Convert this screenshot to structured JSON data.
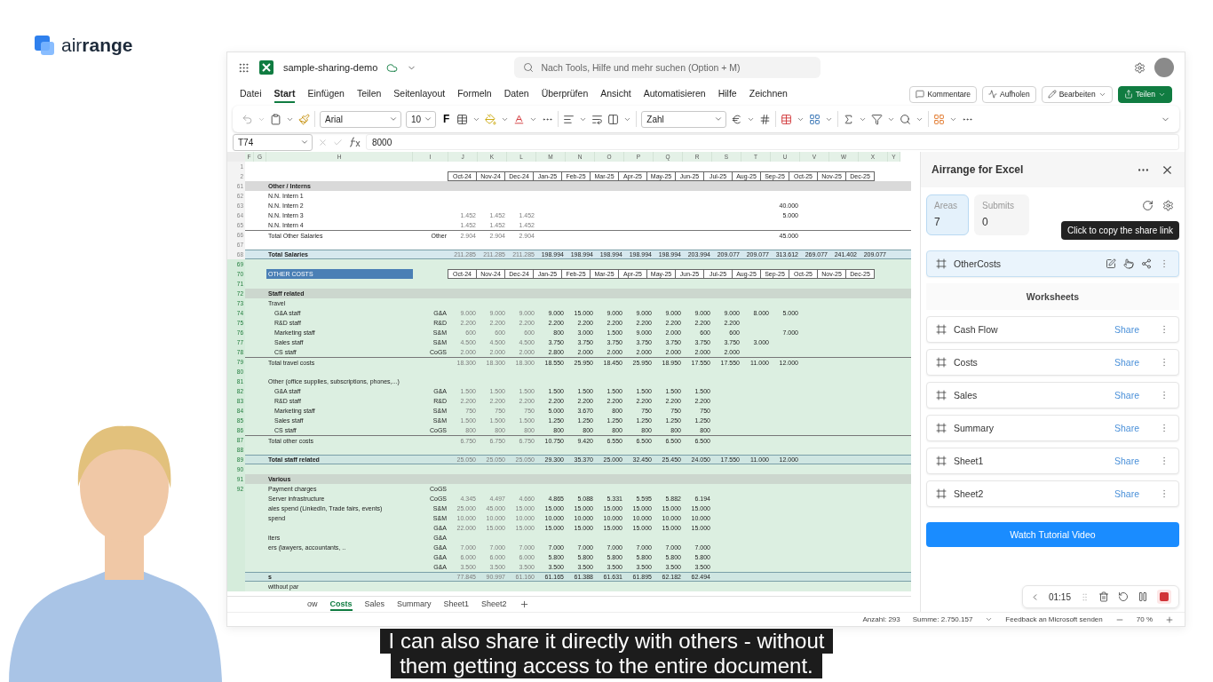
{
  "brand": {
    "name": "air**range**"
  },
  "app": {
    "document": "sample-sharing-demo",
    "search": {
      "placeholder": "Nach Tools, Hilfe und mehr suchen (Option + M)"
    }
  },
  "menu": {
    "tabs": [
      {
        "label": "Datei",
        "selected": false
      },
      {
        "label": "Start",
        "selected": true
      },
      {
        "label": "Einfügen",
        "selected": false
      },
      {
        "label": "Teilen",
        "selected": false
      },
      {
        "label": "Seitenlayout",
        "selected": false
      },
      {
        "label": "Formeln",
        "selected": false
      },
      {
        "label": "Daten",
        "selected": false
      },
      {
        "label": "Überprüfen",
        "selected": false
      },
      {
        "label": "Ansicht",
        "selected": false
      },
      {
        "label": "Automatisieren",
        "selected": false
      },
      {
        "label": "Hilfe",
        "selected": false
      },
      {
        "label": "Zeichnen",
        "selected": false
      }
    ],
    "actions": [
      {
        "label": "Kommentare",
        "kind": "outline"
      },
      {
        "label": "Aufholen",
        "kind": "outline"
      },
      {
        "label": "Bearbeiten",
        "kind": "outline"
      },
      {
        "label": "Teilen",
        "kind": "primary"
      }
    ]
  },
  "ribbon": {
    "font": "Arial",
    "size": "10",
    "bold": "F",
    "number_format": "Zahl"
  },
  "formula_bar": {
    "name_box": "T74",
    "value": "8000"
  },
  "sheet": {
    "lead_columns": [
      "F",
      "G",
      "H",
      "I"
    ],
    "trail_columns": [
      "Y"
    ],
    "columns": [
      {
        "letter": "J",
        "dimmed": true
      },
      {
        "letter": "K",
        "dimmed": true
      },
      {
        "letter": "L",
        "dimmed": true
      },
      {
        "letter": "M",
        "dimmed": false
      },
      {
        "letter": "N",
        "dimmed": false
      },
      {
        "letter": "O",
        "dimmed": false
      },
      {
        "letter": "P",
        "dimmed": false
      },
      {
        "letter": "Q",
        "dimmed": false
      },
      {
        "letter": "R",
        "dimmed": false
      },
      {
        "letter": "S",
        "dimmed": false
      },
      {
        "letter": "T",
        "dimmed": false
      },
      {
        "letter": "U",
        "dimmed": false
      },
      {
        "letter": "V",
        "dimmed": false
      },
      {
        "letter": "W",
        "dimmed": false
      },
      {
        "letter": "X",
        "dimmed": false
      }
    ],
    "rows": [
      {
        "num": "1",
        "kind": "blank",
        "selected": false
      },
      {
        "num": "2",
        "kind": "header",
        "selected": false,
        "labels": [
          "Oct-24",
          "Nov-24",
          "Dec-24",
          "Jan-25",
          "Feb-25",
          "Mar-25",
          "Apr-25",
          "May-25",
          "Jun-25",
          "Jul-25",
          "Aug-25",
          "Sep-25",
          "Oct-25",
          "Nov-25",
          "Dec-25"
        ]
      },
      {
        "num": "61",
        "kind": "section",
        "label": "Other / Interns",
        "selected": false
      },
      {
        "num": "62",
        "kind": "item",
        "label": "N.N. Intern 1",
        "selected": false
      },
      {
        "num": "63",
        "kind": "item",
        "label": "N.N. Intern 2",
        "selected": false,
        "column_u": "40.000"
      },
      {
        "num": "64",
        "kind": "item",
        "label": "N.N. Intern 3",
        "selected": false,
        "values": [
          "1.452",
          "1.452",
          "1.452"
        ],
        "column_u": "5.000"
      },
      {
        "num": "65",
        "kind": "item",
        "label": "N.N. Intern 4",
        "selected": false,
        "values": [
          "1.452",
          "1.452",
          "1.452"
        ]
      },
      {
        "num": "66",
        "kind": "total",
        "label": "Total Other Salaries",
        "category": "Other",
        "selected": false,
        "values": [
          "2.904",
          "2.904",
          "2.904"
        ],
        "column_u": "45.000"
      },
      {
        "num": "67",
        "kind": "blank",
        "selected": false
      },
      {
        "num": "68",
        "kind": "grand",
        "label": "Total Salaries",
        "selected": false,
        "values": [
          "211.285",
          "211.285",
          "211.285",
          "198.994",
          "198.994",
          "198.994",
          "198.994",
          "198.994",
          "203.994",
          "209.077",
          "209.077",
          "313.612",
          "269.077",
          "241.402",
          "209.077"
        ]
      },
      {
        "num": "69",
        "kind": "blank",
        "selected": true
      },
      {
        "num": "70",
        "kind": "title",
        "label": "OTHER COSTS",
        "selected": true,
        "labels": [
          "Oct-24",
          "Nov-24",
          "Dec-24",
          "Jan-25",
          "Feb-25",
          "Mar-25",
          "Apr-25",
          "May-25",
          "Jun-25",
          "Jul-25",
          "Aug-25",
          "Sep-25",
          "Oct-25",
          "Nov-25",
          "Dec-25"
        ]
      },
      {
        "num": "71",
        "kind": "blank",
        "selected": true
      },
      {
        "num": "72",
        "kind": "section",
        "label": "Staff related",
        "selected": true
      },
      {
        "num": "73",
        "kind": "item",
        "label": "Travel",
        "selected": true,
        "children": [
          {
            "num": "74",
            "kind": "item",
            "label": "G&A staff",
            "category": "G&A",
            "selected": true,
            "values": [
              "9.000",
              "9.000",
              "9.000",
              "9.000",
              "15.000",
              "9.000",
              "9.000",
              "9.000",
              "9.000",
              "9.000",
              "8.000",
              "5.000"
            ]
          },
          {
            "num": "75",
            "kind": "item",
            "label": "R&D staff",
            "category": "R&D",
            "selected": true,
            "values": [
              "2.200",
              "2.200",
              "2.200",
              "2.200",
              "2.200",
              "2.200",
              "2.200",
              "2.200",
              "2.200",
              "2.200"
            ]
          },
          {
            "num": "76",
            "kind": "item",
            "label": "Marketing staff",
            "category": "S&M",
            "selected": true,
            "values": [
              "600",
              "600",
              "600",
              "800",
              "3.000",
              "1.500",
              "9.000",
              "2.000",
              "600",
              "600"
            ],
            "column_u": "7.000"
          },
          {
            "num": "77",
            "kind": "item",
            "label": "Sales staff",
            "category": "S&M",
            "selected": true,
            "values": [
              "4.500",
              "4.500",
              "4.500",
              "3.750",
              "3.750",
              "3.750",
              "3.750",
              "3.750",
              "3.750",
              "3.750",
              "3.000"
            ]
          },
          {
            "num": "78",
            "kind": "item",
            "label": "CS staff",
            "category": "CoGS",
            "selected": true,
            "values": [
              "2.000",
              "2.000",
              "2.000",
              "2.800",
              "2.000",
              "2.000",
              "2.000",
              "2.000",
              "2.000",
              "2.000"
            ]
          }
        ]
      },
      {
        "num": "79",
        "kind": "total",
        "label": "Total travel costs",
        "selected": true,
        "values": [
          "18.300",
          "18.300",
          "18.300",
          "18.550",
          "25.950",
          "18.450",
          "25.950",
          "18.950",
          "17.550",
          "17.550",
          "11.000",
          "12.000"
        ]
      },
      {
        "num": "80",
        "kind": "blank",
        "selected": true
      },
      {
        "num": "81",
        "kind": "item",
        "label": "Other (office supplies, subscriptions, phones,...)",
        "selected": true,
        "children": [
          {
            "num": "82",
            "kind": "item",
            "label": "G&A staff",
            "category": "G&A",
            "selected": true,
            "values": [
              "1.500",
              "1.500",
              "1.500",
              "1.500",
              "1.500",
              "1.500",
              "1.500",
              "1.500",
              "1.500"
            ]
          },
          {
            "num": "83",
            "kind": "item",
            "label": "R&D staff",
            "category": "R&D",
            "selected": true,
            "values": [
              "2.200",
              "2.200",
              "2.200",
              "2.200",
              "2.200",
              "2.200",
              "2.200",
              "2.200",
              "2.200"
            ]
          },
          {
            "num": "84",
            "kind": "item",
            "label": "Marketing staff",
            "category": "S&M",
            "selected": true,
            "values": [
              "750",
              "750",
              "750",
              "5.000",
              "3.670",
              "800",
              "750",
              "750",
              "750"
            ]
          },
          {
            "num": "85",
            "kind": "item",
            "label": "Sales staff",
            "category": "S&M",
            "selected": true,
            "values": [
              "1.500",
              "1.500",
              "1.500",
              "1.250",
              "1.250",
              "1.250",
              "1.250",
              "1.250",
              "1.250"
            ]
          },
          {
            "num": "86",
            "kind": "item",
            "label": "CS staff",
            "category": "CoGS",
            "selected": true,
            "values": [
              "800",
              "800",
              "800",
              "800",
              "800",
              "800",
              "800",
              "800",
              "800"
            ]
          }
        ]
      },
      {
        "num": "87",
        "kind": "total",
        "label": "Total other costs",
        "selected": true,
        "values": [
          "6.750",
          "6.750",
          "6.750",
          "10.750",
          "9.420",
          "6.550",
          "6.500",
          "6.500",
          "6.500"
        ]
      },
      {
        "num": "88",
        "kind": "blank",
        "selected": true
      },
      {
        "num": "89",
        "kind": "grand",
        "label": "Total staff related",
        "selected": true,
        "values": [
          "25.050",
          "25.050",
          "25.050",
          "29.300",
          "35.370",
          "25.000",
          "32.450",
          "25.450",
          "24.050",
          "17.550",
          "11.000",
          "12.000"
        ]
      },
      {
        "num": "90",
        "kind": "blank",
        "selected": true
      },
      {
        "num": "91",
        "kind": "section",
        "label": "Various",
        "selected": true
      },
      {
        "num": "92",
        "kind": "item",
        "label": "Payment charges",
        "category": "CoGS",
        "selected": true
      },
      {
        "kind": "item",
        "label": "Server infrastructure",
        "category": "CoGS",
        "selected": true,
        "values": [
          "4.345",
          "4.497",
          "4.660",
          "4.865",
          "5.088",
          "5.331",
          "5.595",
          "5.882",
          "6.194"
        ]
      },
      {
        "kind": "item",
        "label": "ales spend (LinkedIn, Trade fairs, events)",
        "category": "S&M",
        "selected": true,
        "values": [
          "25.000",
          "45.000",
          "15.000",
          "15.000",
          "15.000",
          "15.000",
          "15.000",
          "15.000",
          "15.000"
        ]
      },
      {
        "kind": "item",
        "label": "spend",
        "category": "S&M",
        "selected": true,
        "values": [
          "10.000",
          "10.000",
          "10.000",
          "10.000",
          "10.000",
          "10.000",
          "10.000",
          "10.000",
          "10.000"
        ]
      },
      {
        "kind": "item",
        "category": "G&A",
        "selected": true,
        "values": [
          "22.000",
          "15.000",
          "15.000",
          "15.000",
          "15.000",
          "15.000",
          "15.000",
          "15.000",
          "15.000"
        ]
      },
      {
        "kind": "item",
        "label": "iters",
        "category": "G&A",
        "selected": true
      },
      {
        "kind": "item",
        "label": "ers (lawyers, accountants, ..",
        "category": "G&A",
        "selected": true,
        "values": [
          "7.000",
          "7.000",
          "7.000",
          "7.000",
          "7.000",
          "7.000",
          "7.000",
          "7.000",
          "7.000"
        ]
      },
      {
        "kind": "item",
        "category": "G&A",
        "selected": true,
        "values": [
          "6.000",
          "6.000",
          "6.000",
          "5.800",
          "5.800",
          "5.800",
          "5.800",
          "5.800",
          "5.800"
        ]
      },
      {
        "kind": "item",
        "category": "G&A",
        "selected": true,
        "values": [
          "3.500",
          "3.500",
          "3.500",
          "3.500",
          "3.500",
          "3.500",
          "3.500",
          "3.500",
          "3.500"
        ]
      },
      {
        "kind": "grand",
        "label": "s",
        "selected": true,
        "values": [
          "77.845",
          "90.997",
          "61.160",
          "61.165",
          "61.388",
          "61.631",
          "61.895",
          "62.182",
          "62.494"
        ]
      },
      {
        "kind": "item",
        "label": "without par",
        "selected": true
      }
    ]
  },
  "sheet_tabs": [
    {
      "label": "ow",
      "selected": false
    },
    {
      "label": "Costs",
      "selected": true
    },
    {
      "label": "Sales",
      "selected": false
    },
    {
      "label": "Summary",
      "selected": false
    },
    {
      "label": "Sheet1",
      "selected": false
    },
    {
      "label": "Sheet2",
      "selected": false
    }
  ],
  "status_bar": {
    "count": "Anzahl: 293",
    "sum": "Summe: 2.750.157",
    "feedback": "Feedback an Microsoft senden",
    "zoom": "70 %"
  },
  "addin": {
    "title": "Airrange for Excel",
    "stats": [
      {
        "label": "Areas",
        "value": "7",
        "selected": true
      },
      {
        "label": "Submits",
        "value": "0",
        "selected": false
      }
    ],
    "tooltip": "Click to copy the share link",
    "areas": [
      {
        "name": "OtherCosts",
        "selected": true
      }
    ],
    "worksheets_heading": "Worksheets",
    "worksheets": [
      {
        "name": "Cash Flow",
        "action": "Share"
      },
      {
        "name": "Costs",
        "action": "Share"
      },
      {
        "name": "Sales",
        "action": "Share"
      },
      {
        "name": "Summary",
        "action": "Share"
      },
      {
        "name": "Sheet1",
        "action": "Share"
      },
      {
        "name": "Sheet2",
        "action": "Share"
      }
    ],
    "button": "Watch Tutorial Video"
  },
  "recorder": {
    "time": "01:15"
  },
  "subtitle": {
    "lines": [
      "I can also share it directly with others - without",
      "them getting access to the entire document."
    ]
  }
}
